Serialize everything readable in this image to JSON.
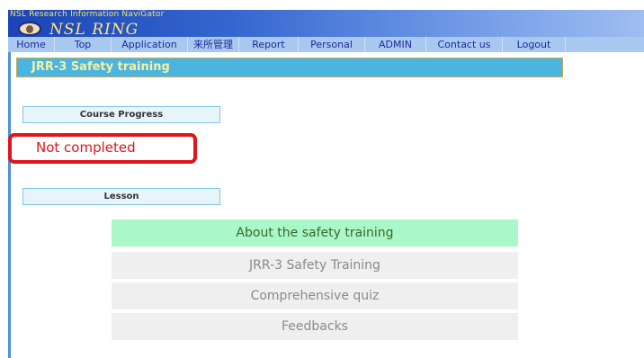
{
  "header": {
    "topline": "NSL Research Information NaviGator",
    "brand": "NSL RING"
  },
  "nav": {
    "items": [
      "Home",
      "Top",
      "Application",
      "来所管理",
      "Report",
      "Personal",
      "ADMIN",
      "Contact us",
      "Logout"
    ]
  },
  "page": {
    "title": "JRR-3 Safety training"
  },
  "progress": {
    "heading": "Course Progress",
    "status": "Not completed"
  },
  "lesson": {
    "heading": "Lesson",
    "items": [
      {
        "label": "About the safety training",
        "active": true
      },
      {
        "label": "JRR-3 Safety Training",
        "active": false
      },
      {
        "label": "Comprehensive quiz",
        "active": false
      },
      {
        "label": "Feedbacks",
        "active": false
      }
    ]
  },
  "colors": {
    "accent_title": "#4bb5e1",
    "status_red": "#e0141a",
    "active_lesson": "#aaf7c9",
    "nav_bg": "#a9c8f0"
  }
}
